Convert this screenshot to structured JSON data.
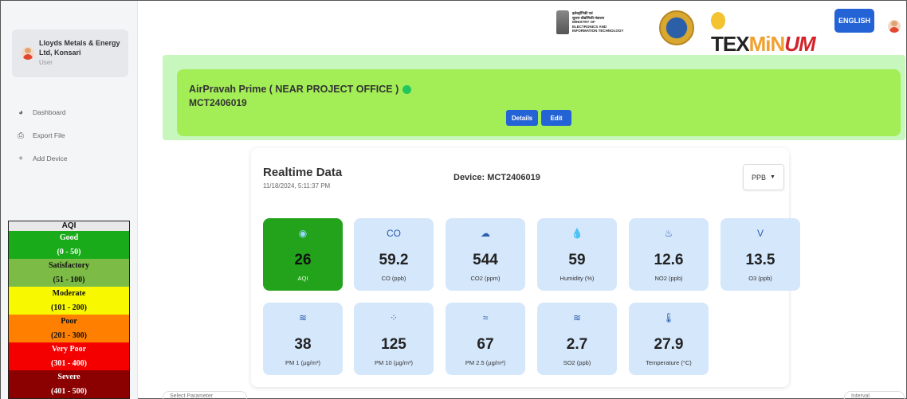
{
  "sidebar": {
    "user": {
      "name": "Lloyds Metals & Energy Ltd, Konsari",
      "role": "User"
    },
    "nav": [
      {
        "label": "Dashboard",
        "icon": "pie-chart-icon"
      },
      {
        "label": "Export File",
        "icon": "export-icon"
      },
      {
        "label": "Add Device",
        "icon": "plus-icon"
      }
    ],
    "aqi_legend": {
      "header": "AQI",
      "levels": [
        {
          "label": "Good",
          "range": "(0 - 50)",
          "color": "#1aab1a",
          "text_color": "#fff"
        },
        {
          "label": "Satisfactory",
          "range": "(51 - 100)",
          "color": "#7cbb46",
          "text_color": "#111"
        },
        {
          "label": "Moderate",
          "range": "(101 - 200)",
          "color": "#f8f800",
          "text_color": "#111"
        },
        {
          "label": "Poor",
          "range": "(201 - 300)",
          "color": "#ff8000",
          "text_color": "#111"
        },
        {
          "label": "Very Poor",
          "range": "(301 - 400)",
          "color": "#f40000",
          "text_color": "#fff"
        },
        {
          "label": "Severe",
          "range": "(401 - 500)",
          "color": "#8b0000",
          "text_color": "#fff"
        }
      ]
    }
  },
  "header": {
    "meity_lines": [
      "इलेक्ट्रॉनिकी एवं",
      "सूचना प्रौद्योगिकी मंत्रालय",
      "MINISTRY OF",
      "ELECTRONICS AND",
      "INFORMATION TECHNOLOGY"
    ],
    "texmin": {
      "tex": "TEX",
      "min": "MiN",
      "ism": "UM"
    },
    "language_button": "ENGLISH"
  },
  "device": {
    "title": "AirPravah Prime ( NEAR PROJECT OFFICE )",
    "id": "MCT2406019",
    "status_color": "#22c55e",
    "details_label": "Details",
    "edit_label": "Edit"
  },
  "realtime": {
    "title": "Realtime Data",
    "timestamp": "11/18/2024, 5:11:37 PM",
    "device_label": "Device: MCT2406019",
    "unit": "PPB",
    "tiles": [
      {
        "icon": "aqi-icon",
        "glyph": "◉",
        "value": "26",
        "label": "AQI"
      },
      {
        "icon": "co-icon",
        "glyph": "CO",
        "value": "59.2",
        "label": "CO (ppb)"
      },
      {
        "icon": "cloud-icon",
        "glyph": "☁",
        "value": "544",
        "label": "CO2 (ppm)"
      },
      {
        "icon": "droplet-icon",
        "glyph": "💧",
        "value": "59",
        "label": "Humidity (%)"
      },
      {
        "icon": "no2-icon",
        "glyph": "♨",
        "value": "12.6",
        "label": "NO2 (ppb)"
      },
      {
        "icon": "o3-icon",
        "glyph": "V",
        "value": "13.5",
        "label": "O3 (ppb)"
      },
      {
        "icon": "pm1-icon",
        "glyph": "≋",
        "value": "38",
        "label": "PM 1 (µg/m³)"
      },
      {
        "icon": "pm10-icon",
        "glyph": "⁘",
        "value": "125",
        "label": "PM 10 (µg/m³)"
      },
      {
        "icon": "pm25-icon",
        "glyph": "≈",
        "value": "67",
        "label": "PM 2.5 (µg/m³)"
      },
      {
        "icon": "so2-icon",
        "glyph": "≋",
        "value": "2.7",
        "label": "SO2 (ppb)"
      },
      {
        "icon": "thermometer-icon",
        "glyph": "🌡",
        "value": "27.9",
        "label": "Temperature (°C)"
      }
    ]
  },
  "bottom": {
    "select_parameter": "Select Parameter",
    "interval": "Interval"
  }
}
